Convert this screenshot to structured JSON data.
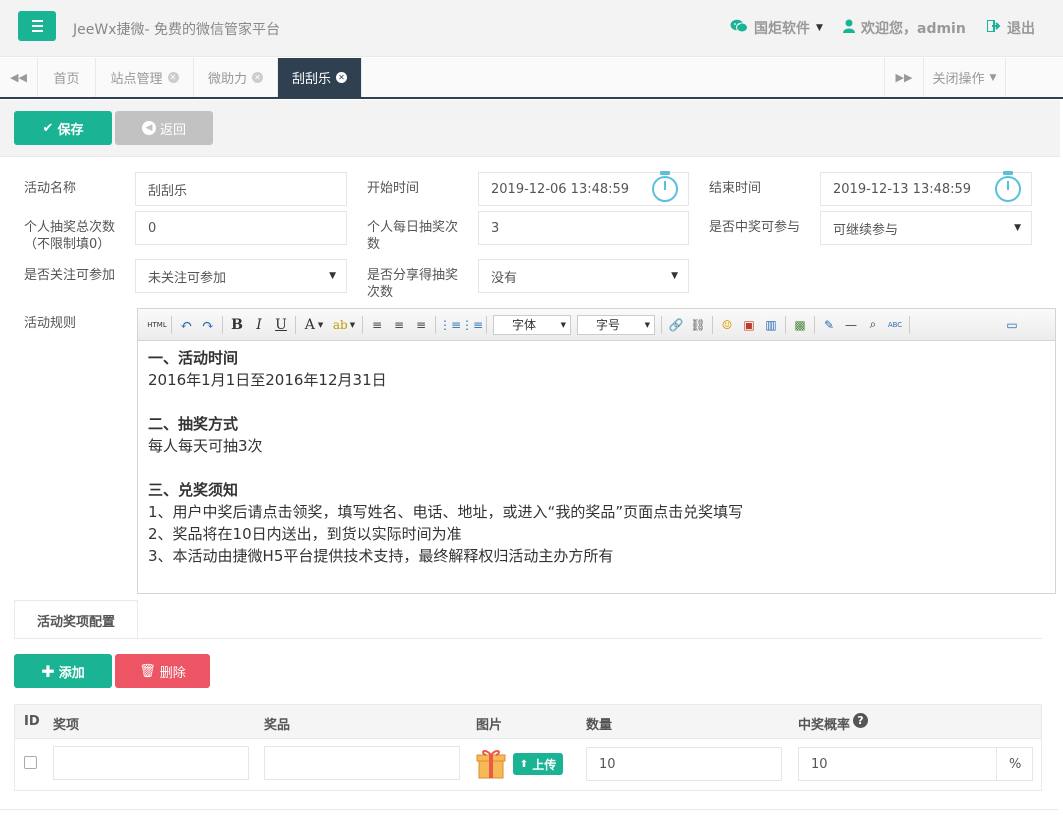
{
  "header": {
    "brand": "JeeWx捷微- 免费的微信管家平台",
    "company": "国炬软件",
    "welcome": "欢迎您，admin",
    "logout": "退出"
  },
  "tabs": {
    "items": [
      "首页",
      "站点管理",
      "微助力",
      "刮刮乐"
    ],
    "active_index": 3,
    "close_ops": "关闭操作"
  },
  "toolbar": {
    "save": "保存",
    "back": "返回"
  },
  "form": {
    "name_label": "活动名称",
    "name_value": "刮刮乐",
    "start_label": "开始时间",
    "start_value": "2019-12-06 13:48:59",
    "end_label": "结束时间",
    "end_value": "2019-12-13 13:48:59",
    "total_label": "个人抽奖总次数",
    "total_note": "（不限制填0）",
    "total_value": "0",
    "daily_label_1": "个人每日抽奖次",
    "daily_label_2": "数",
    "daily_value": "3",
    "win_label": "是否中奖可参与",
    "win_value": "可继续参与",
    "follow_label": "是否关注可参加",
    "follow_value": "未关注可参加",
    "share_label_1": "是否分享得抽奖",
    "share_label_2": "次数",
    "share_value": "没有",
    "rules_label": "活动规则"
  },
  "editor": {
    "toolbar": {
      "html": "HTML",
      "bold": "B",
      "italic": "I",
      "underline": "U",
      "font_color": "A",
      "font_family": "字体",
      "font_size": "字号",
      "spell": "ABC"
    },
    "content": {
      "h1": "一、活动时间",
      "p1": "2016年1月1日至2016年12月31日",
      "h2": "二、抽奖方式",
      "p2": "每人每天可抽3次",
      "h3": "三、兑奖须知",
      "p3": "1、用户中奖后请点击领奖，填写姓名、电话、地址，或进入“我的奖品”页面点击兑奖填写",
      "p4": "2、奖品将在10日内送出，到货以实际时间为准",
      "p5": "3、本活动由捷微H5平台提供技术支持，最终解释权归活动主办方所有"
    }
  },
  "prize_config": {
    "tab_label": "活动奖项配置",
    "add": "添加",
    "delete": "删除",
    "columns": [
      "ID",
      "奖项",
      "奖品",
      "图片",
      "数量",
      "中奖概率"
    ],
    "row": {
      "upload": "上传",
      "quantity": "10",
      "probability": "10",
      "percent": "%"
    }
  },
  "colors": {
    "primary": "#1ab394",
    "danger": "#ed5565",
    "dark_tab": "#2f4050",
    "info": "#5bc0de"
  }
}
